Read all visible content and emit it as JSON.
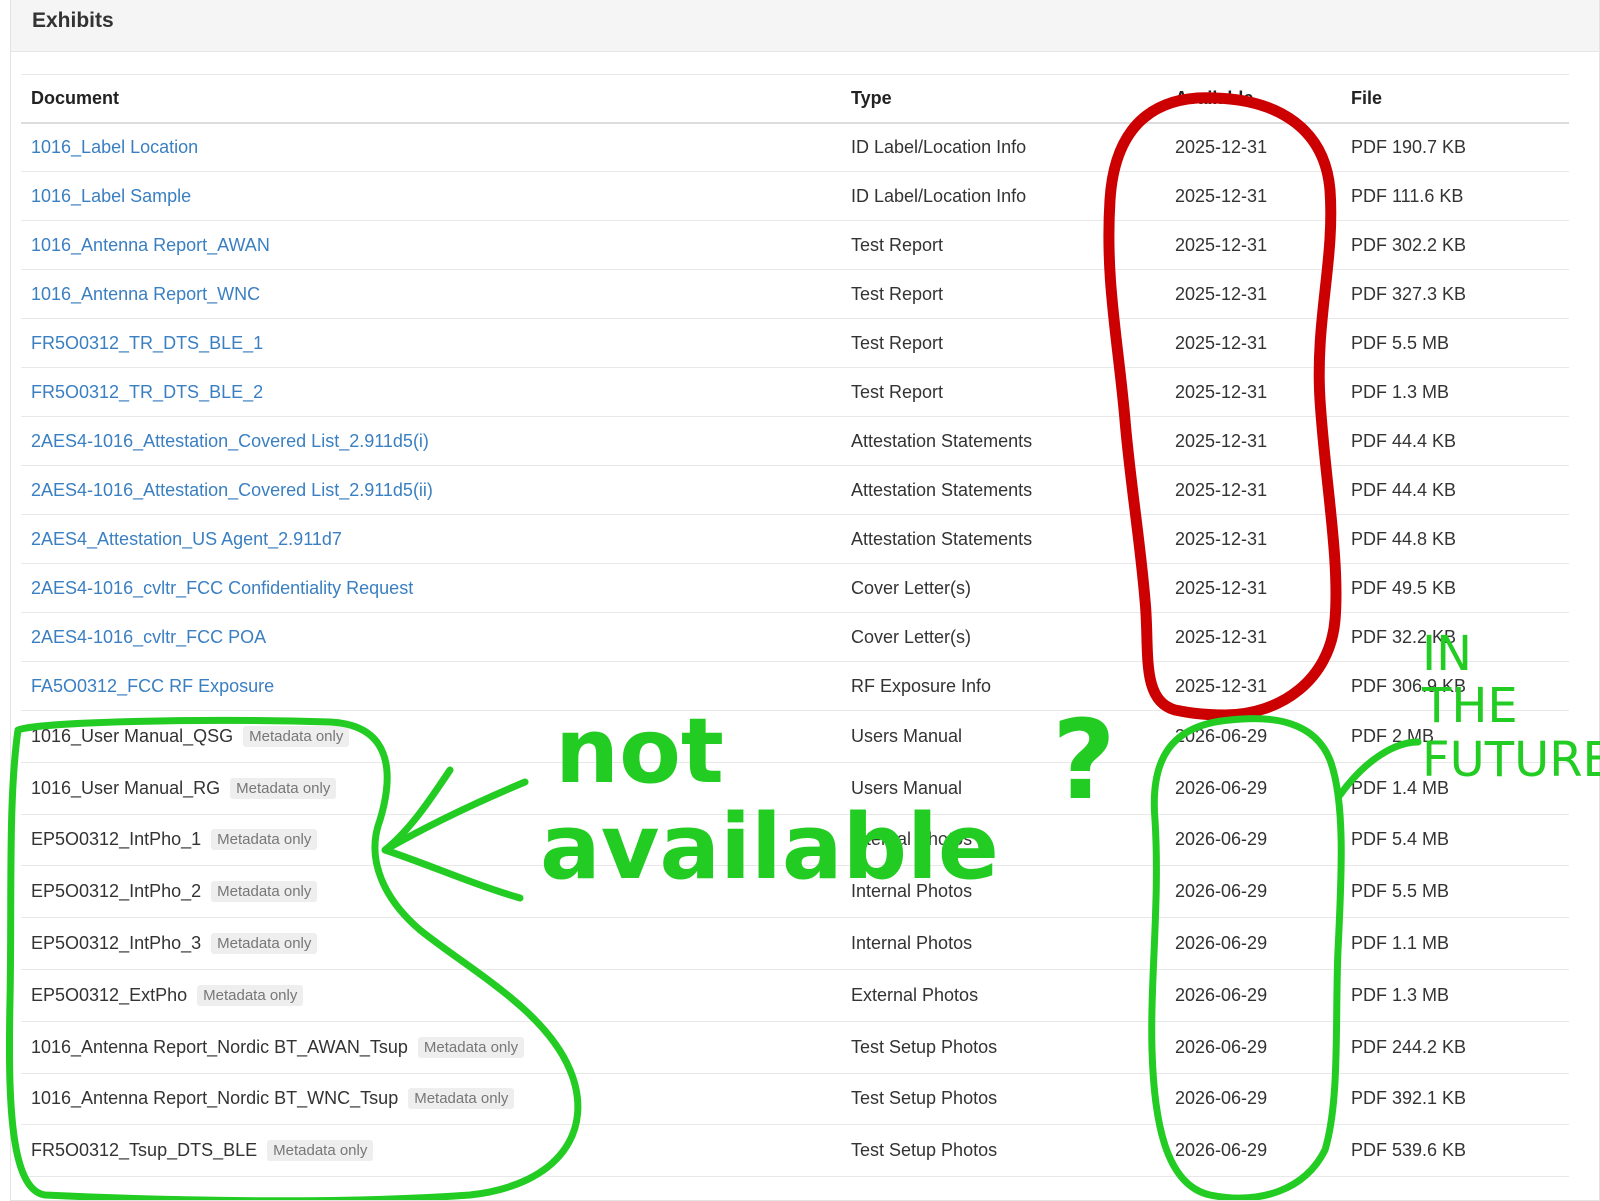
{
  "panel": {
    "title": "Exhibits"
  },
  "table": {
    "columns": [
      "Document",
      "Type",
      "Available",
      "File"
    ],
    "link_rows": [
      {
        "document": "1016_Label Location",
        "type": "ID Label/Location Info",
        "available": "2025-12-31",
        "file": "PDF 190.7 KB"
      },
      {
        "document": "1016_Label Sample",
        "type": "ID Label/Location Info",
        "available": "2025-12-31",
        "file": "PDF 111.6 KB"
      },
      {
        "document": "1016_Antenna Report_AWAN",
        "type": "Test Report",
        "available": "2025-12-31",
        "file": "PDF 302.2 KB"
      },
      {
        "document": "1016_Antenna Report_WNC",
        "type": "Test Report",
        "available": "2025-12-31",
        "file": "PDF 327.3 KB"
      },
      {
        "document": "FR5O0312_TR_DTS_BLE_1",
        "type": "Test Report",
        "available": "2025-12-31",
        "file": "PDF 5.5 MB"
      },
      {
        "document": "FR5O0312_TR_DTS_BLE_2",
        "type": "Test Report",
        "available": "2025-12-31",
        "file": "PDF 1.3 MB"
      },
      {
        "document": "2AES4-1016_Attestation_Covered List_2.911d5(i)",
        "type": "Attestation Statements",
        "available": "2025-12-31",
        "file": "PDF 44.4 KB"
      },
      {
        "document": "2AES4-1016_Attestation_Covered List_2.911d5(ii)",
        "type": "Attestation Statements",
        "available": "2025-12-31",
        "file": "PDF 44.4 KB"
      },
      {
        "document": "2AES4_Attestation_US Agent_2.911d7",
        "type": "Attestation Statements",
        "available": "2025-12-31",
        "file": "PDF 44.8 KB"
      },
      {
        "document": "2AES4-1016_cvltr_FCC Confidentiality Request",
        "type": "Cover Letter(s)",
        "available": "2025-12-31",
        "file": "PDF 49.5 KB"
      },
      {
        "document": "2AES4-1016_cvltr_FCC POA",
        "type": "Cover Letter(s)",
        "available": "2025-12-31",
        "file": "PDF 32.2 KB"
      },
      {
        "document": "FA5O0312_FCC RF Exposure",
        "type": "RF Exposure Info",
        "available": "2025-12-31",
        "file": "PDF 306.9 KB"
      }
    ],
    "meta_rows": [
      {
        "document": "1016_User Manual_QSG",
        "badge": "Metadata only",
        "type": "Users Manual",
        "available": "2026-06-29",
        "file": "PDF 2 MB"
      },
      {
        "document": "1016_User Manual_RG",
        "badge": "Metadata only",
        "type": "Users Manual",
        "available": "2026-06-29",
        "file": "PDF 1.4 MB"
      },
      {
        "document": "EP5O0312_IntPho_1",
        "badge": "Metadata only",
        "type": "Internal Photos",
        "available": "2026-06-29",
        "file": "PDF 5.4 MB"
      },
      {
        "document": "EP5O0312_IntPho_2",
        "badge": "Metadata only",
        "type": "Internal Photos",
        "available": "2026-06-29",
        "file": "PDF 5.5 MB"
      },
      {
        "document": "EP5O0312_IntPho_3",
        "badge": "Metadata only",
        "type": "Internal Photos",
        "available": "2026-06-29",
        "file": "PDF 1.1 MB"
      },
      {
        "document": "EP5O0312_ExtPho",
        "badge": "Metadata only",
        "type": "External Photos",
        "available": "2026-06-29",
        "file": "PDF 1.3 MB"
      },
      {
        "document": "1016_Antenna Report_Nordic BT_AWAN_Tsup",
        "badge": "Metadata only",
        "type": "Test Setup Photos",
        "available": "2026-06-29",
        "file": "PDF 244.2 KB"
      },
      {
        "document": "1016_Antenna Report_Nordic BT_WNC_Tsup",
        "badge": "Metadata only",
        "type": "Test Setup Photos",
        "available": "2026-06-29",
        "file": "PDF 392.1 KB"
      },
      {
        "document": "FR5O0312_Tsup_DTS_BLE",
        "badge": "Metadata only",
        "type": "Test Setup Photos",
        "available": "2026-06-29",
        "file": "PDF 539.6 KB"
      }
    ]
  },
  "annotations": {
    "not_available": "not available",
    "question_mark": "?",
    "in_the_future": [
      "IN",
      "THE",
      "FUTURE"
    ],
    "colors": {
      "red": "#cc0000",
      "green": "#22cc22"
    }
  }
}
